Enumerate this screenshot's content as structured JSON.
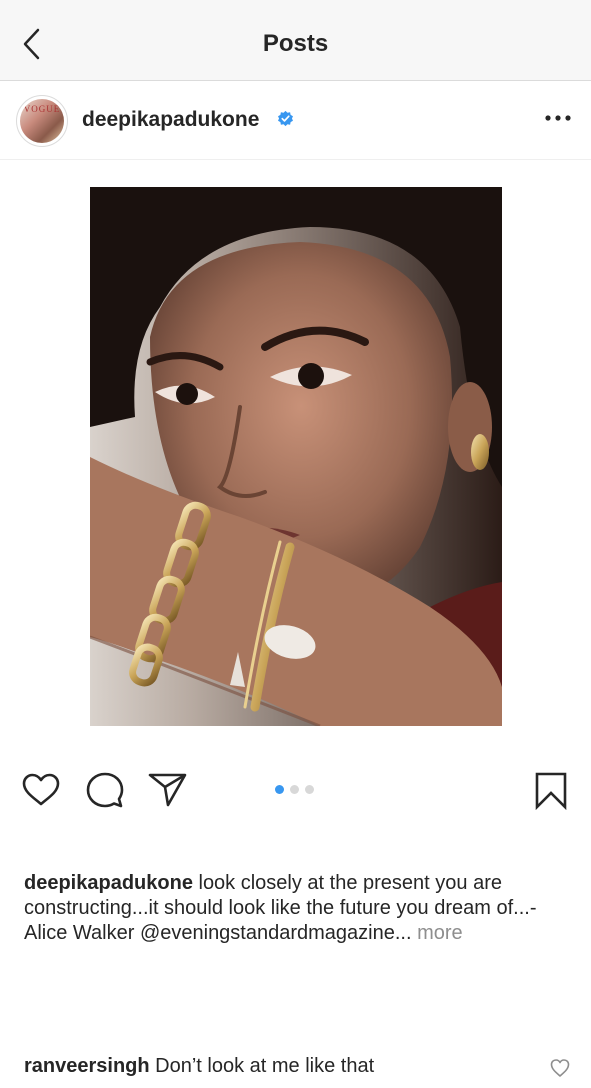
{
  "header": {
    "title": "Posts",
    "back_icon": "chevron-left-icon"
  },
  "post": {
    "username": "deepikapadukone",
    "verified": true,
    "avatar_text": "VOGUE",
    "more_icon": "ellipsis-icon",
    "image_count": 3,
    "active_index": 0
  },
  "actions": {
    "like_icon": "heart-icon",
    "comment_icon": "comment-icon",
    "share_icon": "paper-plane-icon",
    "save_icon": "bookmark-icon"
  },
  "caption": {
    "username": "deepikapadukone",
    "text": " look closely at the present you are constructing...it should look like the future you dream of...-Alice Walker @eveningstandardmagazine...",
    "more": " more"
  },
  "comment": {
    "username": "ranveersingh",
    "text": " Don’t look at me like that"
  },
  "colors": {
    "accent": "#3897f0",
    "text": "#262626",
    "secondary": "#8e8e8e"
  }
}
